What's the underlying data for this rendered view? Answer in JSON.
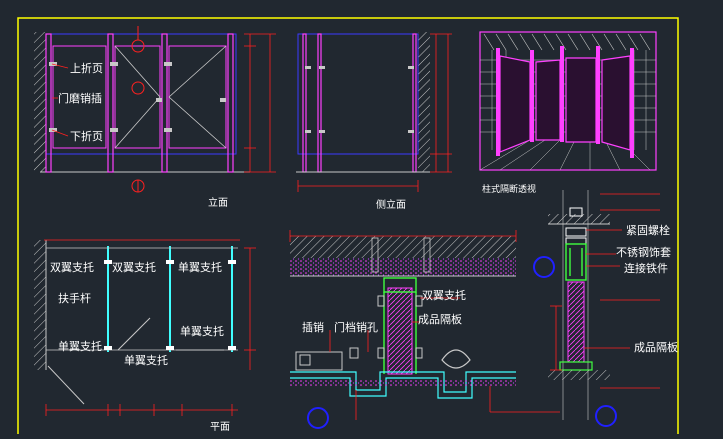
{
  "colors": {
    "background": "#212830",
    "frame": "#ffff00",
    "partition": "#ff40ff",
    "outline": "#3a3aff",
    "dimension": "#ff2020",
    "wall_hatch": "#c8c8c8",
    "label": "#ffffff",
    "fitting": "#40ffff",
    "hardware": "#40ff40",
    "concrete": "#ff40ff",
    "marker": "#2020ff"
  },
  "labels": {
    "front_elevation": {
      "upper_hinge": "上折页",
      "door_latch": "门磨销插",
      "lower_hinge": "下折页",
      "caption": "立面"
    },
    "side_elevation": {
      "caption": "侧立面"
    },
    "perspective": {
      "caption": "柱式隔断透视"
    },
    "plan": {
      "double_bracket_1": "双翼支托",
      "double_bracket_2": "双翼支托",
      "single_bracket_1": "单翼支托",
      "handrail": "扶手杆",
      "single_bracket_2": "单翼支托",
      "single_bracket_3": "单翼支托",
      "single_bracket_4": "单翼支托",
      "caption": "平面"
    },
    "section_mid": {
      "double_bracket": "双翼支托",
      "panel": "成品隔板",
      "latch_hole_a": "插销",
      "latch_hole_b": "门档销孔"
    },
    "section_right": {
      "fixing_bolt": "紧固螺栓",
      "steel_sleeve": "不锈钢饰套",
      "connector": "连接铁件",
      "panel": "成品隔板"
    }
  }
}
